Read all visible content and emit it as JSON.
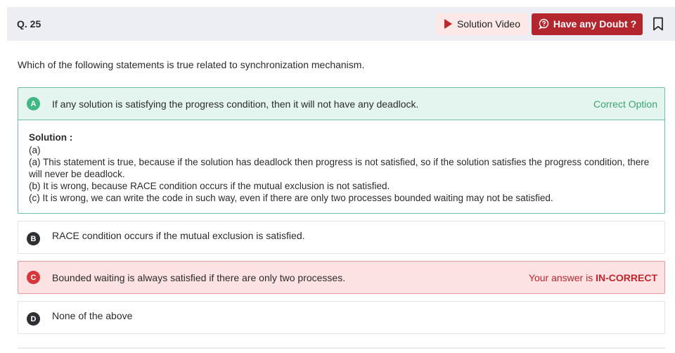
{
  "header": {
    "question_number": "Q. 25",
    "solution_video_label": "Solution Video",
    "doubt_label": "Have any Doubt ?",
    "icons": {
      "video": "play-icon",
      "doubt": "question-bubble-icon",
      "bookmark": "bookmark-icon"
    }
  },
  "question": {
    "text": "Which of the following statements is true related to synchronization mechanism."
  },
  "options": [
    {
      "letter": "A",
      "text": "If any solution is satisfying the progress condition, then it will not have any deadlock.",
      "status": "Correct Option",
      "state": "correct",
      "solution": {
        "title": "Solution :",
        "lines": [
          "(a)",
          "(a) This statement is true, because if the solution has deadlock then progress is not satisfied, so if the solution satisfies the progress condition, there will never be deadlock.",
          "(b) It is wrong, because RACE condition occurs if the mutual exclusion is not satisfied.",
          "(c) It is wrong, we can write the code in such way, even if there are only two processes bounded waiting may not be satisfied."
        ]
      }
    },
    {
      "letter": "B",
      "text": "RACE condition occurs if the mutual exclusion is satisfied.",
      "state": "neutral"
    },
    {
      "letter": "C",
      "text": "Bounded waiting is always satisfied if there are only two processes.",
      "status_prefix": "Your answer is ",
      "status_emphasis": "IN-CORRECT",
      "state": "incorrect"
    },
    {
      "letter": "D",
      "text": "None of the above",
      "state": "neutral"
    }
  ],
  "colors": {
    "correct_bg": "#e3f5ee",
    "correct_border": "#6fc2a3",
    "correct_text": "#3aa676",
    "incorrect_bg": "#fde2e3",
    "incorrect_text": "#c0262c",
    "doubt_button": "#b3262d"
  }
}
